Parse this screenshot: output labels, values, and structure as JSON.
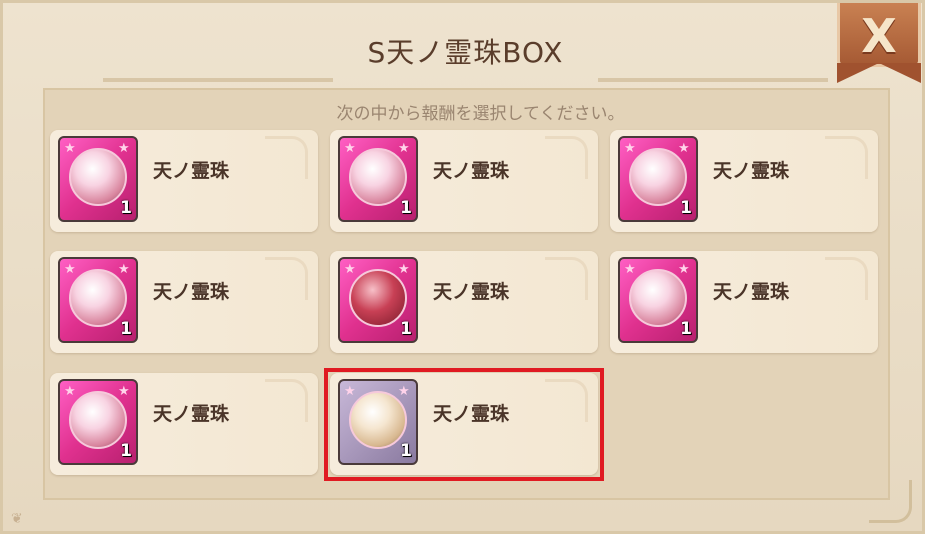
{
  "dialog": {
    "title": "S天ノ霊珠BOX",
    "instruction": "次の中から報酬を選択してください。",
    "close_label": "X"
  },
  "items": [
    {
      "name": "天ノ霊珠",
      "count": "1",
      "icon": "orb-crystal-icon"
    },
    {
      "name": "天ノ霊珠",
      "count": "1",
      "icon": "orb-girl-icon"
    },
    {
      "name": "天ノ霊珠",
      "count": "1",
      "icon": "orb-bird-icon"
    },
    {
      "name": "天ノ霊珠",
      "count": "1",
      "icon": "orb-girl-icon"
    },
    {
      "name": "天ノ霊珠",
      "count": "1",
      "icon": "orb-red-icon"
    },
    {
      "name": "天ノ霊珠",
      "count": "1",
      "icon": "orb-girl-icon"
    },
    {
      "name": "天ノ霊珠",
      "count": "1",
      "icon": "orb-girl-icon"
    },
    {
      "name": "天ノ霊珠",
      "count": "1",
      "icon": "orb-girl-icon"
    }
  ],
  "colors": {
    "highlight": "#e01a22",
    "icon_frame": "#e0318f",
    "close_button": "#a65a34"
  }
}
